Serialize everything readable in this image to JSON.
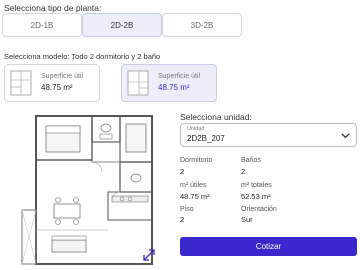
{
  "plan_type": {
    "title": "Selecciona tipo de planta:",
    "options": [
      "2D-1B",
      "2D-2B",
      "3D-2B"
    ],
    "selected": "2D-2B"
  },
  "model": {
    "title": "Selecciona modelo: Todo 2 dormitorio y 2 baño",
    "cards": [
      {
        "label": "Superficie útil",
        "area": "48.75 m²"
      },
      {
        "label": "Superficie útil",
        "area": "48.75 m²"
      }
    ]
  },
  "unit": {
    "title": "Selecciona unidad:",
    "select_label": "Unidad",
    "select_value": "2D2B_207"
  },
  "specs": [
    {
      "label": "Dormitorio",
      "value": "2"
    },
    {
      "label": "Baños",
      "value": "2"
    },
    {
      "label": "m² útiles",
      "value": "48.75 m²"
    },
    {
      "label": "m² totales",
      "value": "52.53 m²"
    },
    {
      "label": "Piso",
      "value": "2"
    },
    {
      "label": "Orientación",
      "value": "Sur"
    }
  ],
  "cta": {
    "label": "Cotizar"
  },
  "colors": {
    "accent": "#3b28cc",
    "selected_bg": "#eceef9"
  },
  "icons": [
    "floor-plan-thumbnail",
    "chevron-down-icon",
    "expand-icon"
  ]
}
